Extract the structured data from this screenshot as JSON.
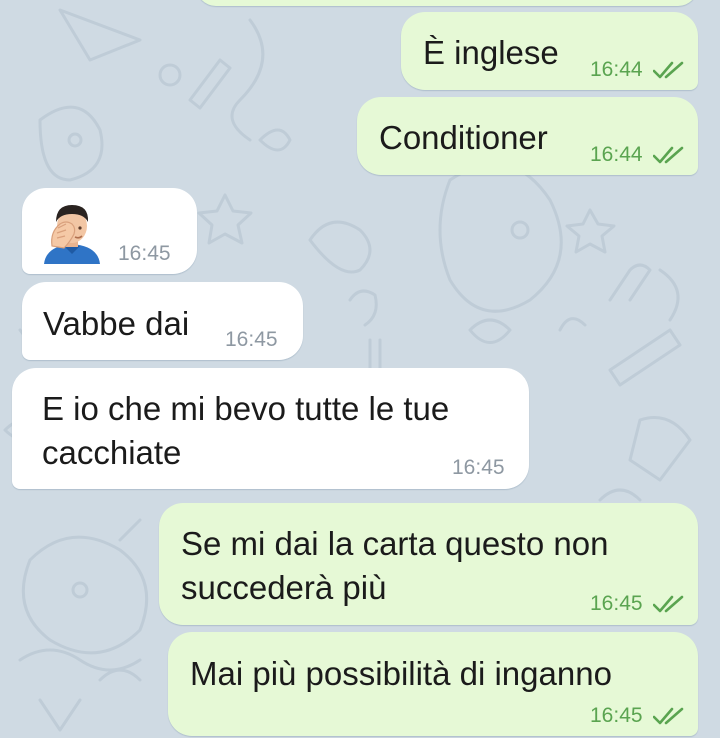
{
  "messages": [
    {
      "direction": "outgoing",
      "text": "È inglese",
      "time": "16:44",
      "status": "read"
    },
    {
      "direction": "outgoing",
      "text": "Conditioner",
      "time": "16:44",
      "status": "read"
    },
    {
      "direction": "incoming",
      "emoji": "face-palm-man-emoji",
      "time": "16:45"
    },
    {
      "direction": "incoming",
      "text": "Vabbe dai",
      "time": "16:45"
    },
    {
      "direction": "incoming",
      "text": "E io che mi bevo tutte le tue\ncacchiate",
      "time": "16:45"
    },
    {
      "direction": "outgoing",
      "text": "Se mi dai la carta questo non\nsuccederà più",
      "time": "16:45",
      "status": "read"
    },
    {
      "direction": "outgoing",
      "text": "Mai più possibilità di inganno",
      "time": "16:45",
      "status": "read"
    }
  ],
  "colors": {
    "background": "#cfdae3",
    "outgoing_bubble": "#e6f9d6",
    "incoming_bubble": "#ffffff",
    "outgoing_time": "#5aa450",
    "incoming_time": "#8e98a2"
  },
  "icons": {
    "read_receipt": "double-check-icon"
  }
}
